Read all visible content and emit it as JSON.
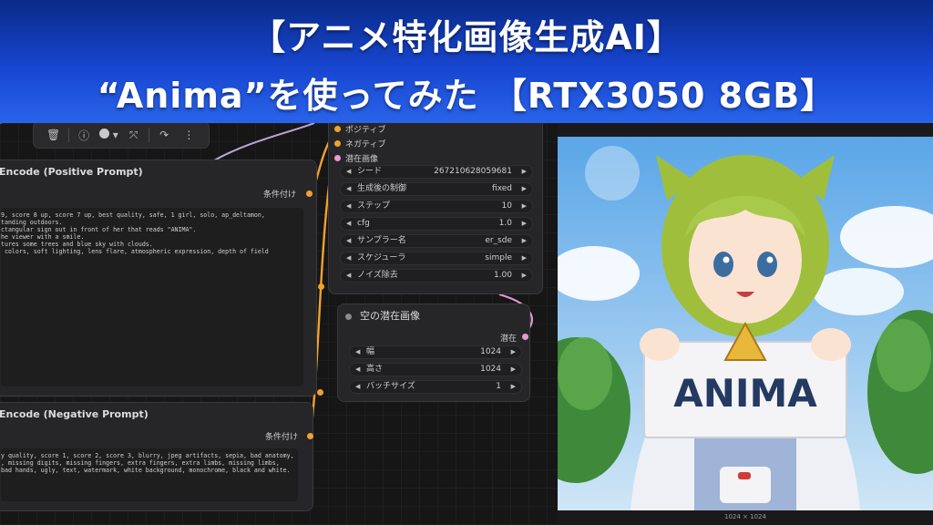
{
  "banner": {
    "line1": "【アニメ特化画像生成AI】",
    "line2": "“Anima”を使ってみた 【RTX3050 8GB】"
  },
  "toolbar": {
    "icons": [
      "trash-icon",
      "info-icon",
      "color-dot-icon",
      "chevron-down-icon",
      "bypass-icon",
      "redo-icon",
      "more-icon"
    ]
  },
  "sampler_node": {
    "inputs": [
      "ポジティブ",
      "ネガティブ",
      "潜在画像"
    ],
    "widgets": [
      {
        "label": "シード",
        "value": "267210628059681"
      },
      {
        "label": "生成後の制御",
        "value": "fixed"
      },
      {
        "label": "ステップ",
        "value": "10"
      },
      {
        "label": "cfg",
        "value": "1.0"
      },
      {
        "label": "サンプラー名",
        "value": "er_sde"
      },
      {
        "label": "スケジューラ",
        "value": "simple"
      },
      {
        "label": "ノイズ除去",
        "value": "1.00"
      }
    ]
  },
  "positive_node": {
    "title": "Encode (Positive Prompt)",
    "output_label": "条件付け",
    "prompt": "9, score 8 up, score 7 up, best quality, safe, 1 girl, solo, ap_deltamon,\ntanding outdoors.\nctangular sign out in front of her that reads \"ANIMA\".\nhe viewer with a smile.\ntures some trees and blue sky with clouds.\n colors, soft lighting, lens flare, atmospheric expression, depth of field"
  },
  "negative_node": {
    "title": "Encode (Negative Prompt)",
    "output_label": "条件付け",
    "prompt": "y quality, score 1, score 2, score 3, blurry, jpeg artifacts, sepia, bad anatomy,\n, missing digits, missing fingers, extra fingers, extra limbs, missing limbs,\nbad hands, ugly, text, watermark, white background, monochrome, black and white."
  },
  "latent_node": {
    "title": "空の潜在画像",
    "output_label": "潜在",
    "widgets": [
      {
        "label": "幅",
        "value": "1024"
      },
      {
        "label": "高さ",
        "value": "1024"
      },
      {
        "label": "バッチサイズ",
        "value": "1"
      }
    ]
  },
  "preview": {
    "sign_text": "ANIMA",
    "caption": "1024 × 1024"
  },
  "colors": {
    "banner": "#1746d0",
    "wire_conditioning": "#f0a22e",
    "wire_latent": "#e69ad8",
    "node_bg": "#262628"
  }
}
